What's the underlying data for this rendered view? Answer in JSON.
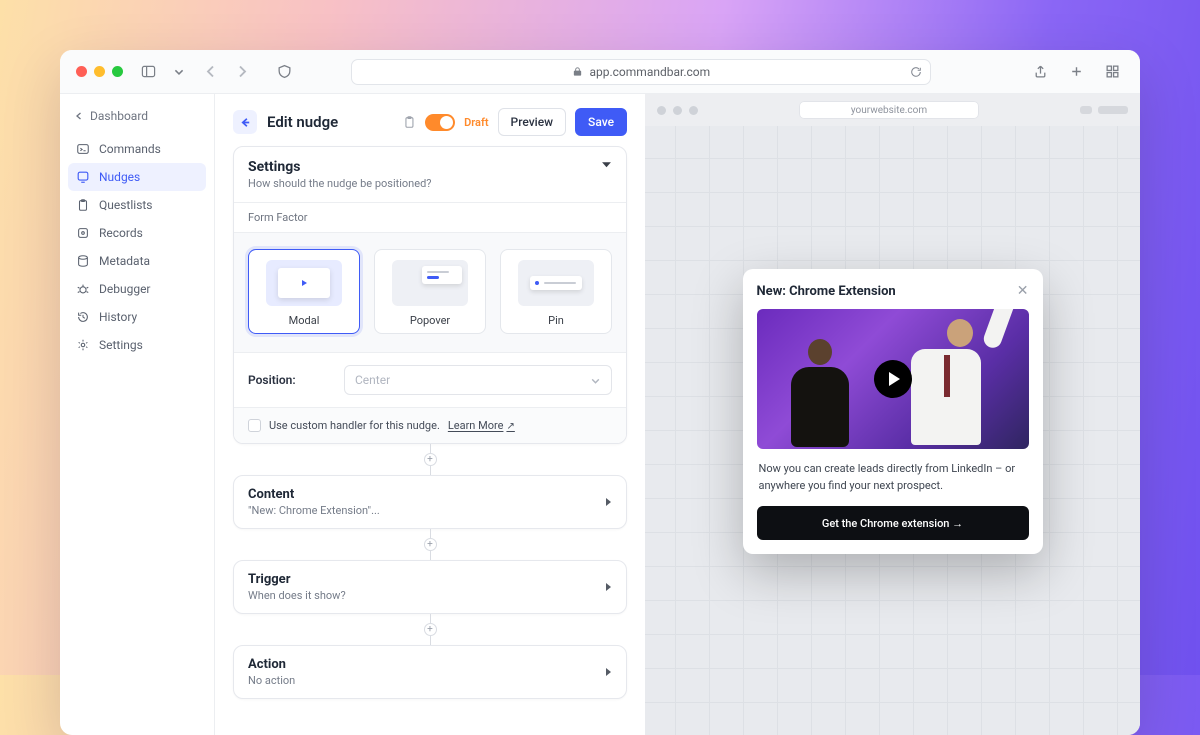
{
  "browser": {
    "address": "app.commandbar.com"
  },
  "sidebar": {
    "back": "Dashboard",
    "items": [
      {
        "label": "Commands"
      },
      {
        "label": "Nudges"
      },
      {
        "label": "Questlists"
      },
      {
        "label": "Records"
      },
      {
        "label": "Metadata"
      },
      {
        "label": "Debugger"
      },
      {
        "label": "History"
      },
      {
        "label": "Settings"
      }
    ]
  },
  "editor": {
    "title": "Edit nudge",
    "status": "Draft",
    "preview_btn": "Preview",
    "save_btn": "Save",
    "settings": {
      "title": "Settings",
      "subtitle": "How should the nudge be positioned?",
      "form_factor_label": "Form Factor",
      "options": {
        "modal": "Modal",
        "popover": "Popover",
        "pin": "Pin"
      },
      "position_label": "Position:",
      "position_value": "Center",
      "handler_label": "Use custom handler for this nudge.",
      "learn_more": "Learn More"
    },
    "flow": {
      "content": {
        "title": "Content",
        "subtitle": "\"New: Chrome Extension\"..."
      },
      "trigger": {
        "title": "Trigger",
        "subtitle": "When does it show?"
      },
      "action": {
        "title": "Action",
        "subtitle": "No action"
      }
    }
  },
  "preview": {
    "site": "yourwebsite.com",
    "modal": {
      "title": "New: Chrome Extension",
      "body": "Now you can create leads directly from LinkedIn – or anywhere you find your next prospect.",
      "cta": "Get the Chrome extension →"
    }
  }
}
